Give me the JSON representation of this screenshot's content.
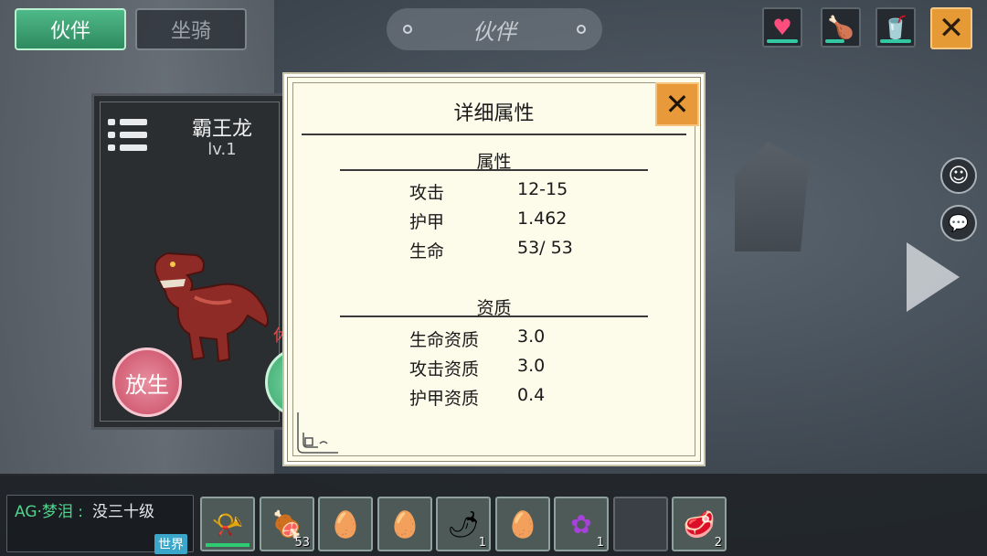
{
  "top_bar": {
    "tabs": [
      {
        "label": "伙伴",
        "active": true
      },
      {
        "label": "坐骑",
        "active": false
      }
    ],
    "title": "伙伴",
    "status_icons": [
      {
        "name": "heart-icon",
        "glyph": "♥",
        "color": "#ff4d7e"
      },
      {
        "name": "drumstick-icon",
        "glyph": "🍗",
        "color": "#f0c419"
      },
      {
        "name": "water-cup-icon",
        "glyph": "🥤",
        "color": "#38d0b0"
      }
    ],
    "close_glyph": "✕"
  },
  "side": {
    "emoji_glyph": "☺",
    "chat_glyph": "💬"
  },
  "pet": {
    "name": "霸王龙",
    "level": "lv.1",
    "release_label": "放生",
    "hint_fragment": "休"
  },
  "dialog": {
    "title": "详细属性",
    "close_glyph": "✕",
    "sections": [
      {
        "title": "属性",
        "rows": [
          {
            "label": "攻击",
            "value": "12-15"
          },
          {
            "label": "护甲",
            "value": "1.462"
          },
          {
            "label": "生命",
            "value": "53/ 53"
          }
        ]
      },
      {
        "title": "资质",
        "rows": [
          {
            "label": "生命资质",
            "value": "3.0"
          },
          {
            "label": "攻击资质",
            "value": "3.0"
          },
          {
            "label": "护甲资质",
            "value": "0.4"
          }
        ]
      }
    ]
  },
  "chat": {
    "name": "AG·梦泪 :",
    "message": "没三十级",
    "channel": "世界"
  },
  "hotbar": [
    {
      "name": "horn-icon",
      "glyph": "📯",
      "count": "",
      "durability": true
    },
    {
      "name": "steak-dish-icon",
      "glyph": "🍖",
      "count": "53",
      "durability": false
    },
    {
      "name": "pet-egg-icon",
      "glyph": "🥚",
      "count": "",
      "durability": false
    },
    {
      "name": "pet-egg-icon",
      "glyph": "🥚",
      "count": "",
      "durability": false
    },
    {
      "name": "chili-pepper-icon",
      "glyph": "🌶",
      "count": "1",
      "durability": false
    },
    {
      "name": "pet-egg-icon",
      "glyph": "🥚",
      "count": "",
      "durability": false
    },
    {
      "name": "purple-flower-icon",
      "glyph": "✿",
      "count": "1",
      "durability": false
    },
    {
      "name": "empty-slot",
      "glyph": "",
      "count": "",
      "durability": false
    },
    {
      "name": "raw-meat-icon",
      "glyph": "🥩",
      "count": "2",
      "durability": false
    }
  ]
}
